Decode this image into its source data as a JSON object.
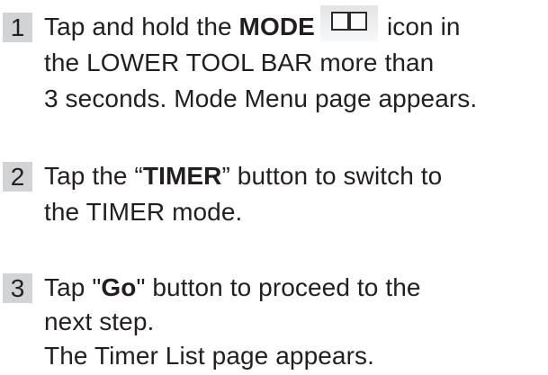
{
  "steps": [
    {
      "number": "1",
      "line1": {
        "part1": "Tap and hold the ",
        "bold": "MODE",
        "part2": "icon in"
      },
      "line2": "the LOWER TOOL BAR more than",
      "line3": "3 seconds. Mode Menu page appears.",
      "icon": "mode-book-icon"
    },
    {
      "number": "2",
      "line1": {
        "part1": "Tap the “",
        "bold": "TIMER",
        "part2": "” button to switch to"
      },
      "line2": "the TIMER mode."
    },
    {
      "number": "3",
      "line1": {
        "part1": "Tap \"",
        "bold": "Go",
        "part2": "\" button to proceed to the"
      },
      "line2": "next step.",
      "line3": "The Timer List page appears."
    }
  ],
  "colors": {
    "number_box_bg": "#d1d3d4",
    "text": "#231f20",
    "icon_stroke": "#2a2a2a"
  }
}
